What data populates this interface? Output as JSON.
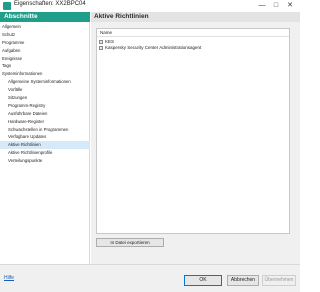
{
  "window": {
    "title": "Eigenschaften: XX2BPC04",
    "minimize_glyph": "—",
    "maximize_glyph": "□",
    "close_glyph": "✕"
  },
  "sidebar": {
    "header": "Abschnitte",
    "items": [
      {
        "label": "Allgemein",
        "indent": false,
        "selected": false
      },
      {
        "label": "Schutz",
        "indent": false,
        "selected": false
      },
      {
        "label": "Programme",
        "indent": false,
        "selected": false
      },
      {
        "label": "Aufgaben",
        "indent": false,
        "selected": false
      },
      {
        "label": "Ereignisse",
        "indent": false,
        "selected": false
      },
      {
        "label": "Tags",
        "indent": false,
        "selected": false
      },
      {
        "label": "Systeminformationen",
        "indent": false,
        "selected": false
      },
      {
        "label": "Allgemeine Systeminformationen",
        "indent": true,
        "selected": false
      },
      {
        "label": "Vorfälle",
        "indent": true,
        "selected": false
      },
      {
        "label": "Sitzungen",
        "indent": true,
        "selected": false
      },
      {
        "label": "Programm-Registry",
        "indent": true,
        "selected": false
      },
      {
        "label": "Ausführbare Dateien",
        "indent": true,
        "selected": false
      },
      {
        "label": "Hardware-Register",
        "indent": true,
        "selected": false
      },
      {
        "label": "Schwachstellen in Programmen",
        "indent": true,
        "selected": false
      },
      {
        "label": "Verfügbare Updates",
        "indent": true,
        "selected": false
      },
      {
        "label": "Aktive Richtlinien",
        "indent": true,
        "selected": true
      },
      {
        "label": "Aktive Richtlinienprofile",
        "indent": true,
        "selected": false
      },
      {
        "label": "Verteilungspunkte",
        "indent": true,
        "selected": false
      }
    ]
  },
  "main": {
    "title": "Aktive Richtlinien",
    "list": {
      "column_header": "Name",
      "rows": [
        {
          "name": "KES"
        },
        {
          "name": "Kaspersky Security Center Administrationsagent"
        }
      ]
    },
    "export_button": "In Datei exportieren"
  },
  "footer": {
    "help_link": "Hilfe",
    "ok_button": "OK",
    "cancel_button": "Abbrechen",
    "apply_button": "Übernehmen"
  },
  "colors": {
    "accent": "#1f9e89",
    "selection": "#d6e9f8",
    "link": "#1a5fb4"
  }
}
